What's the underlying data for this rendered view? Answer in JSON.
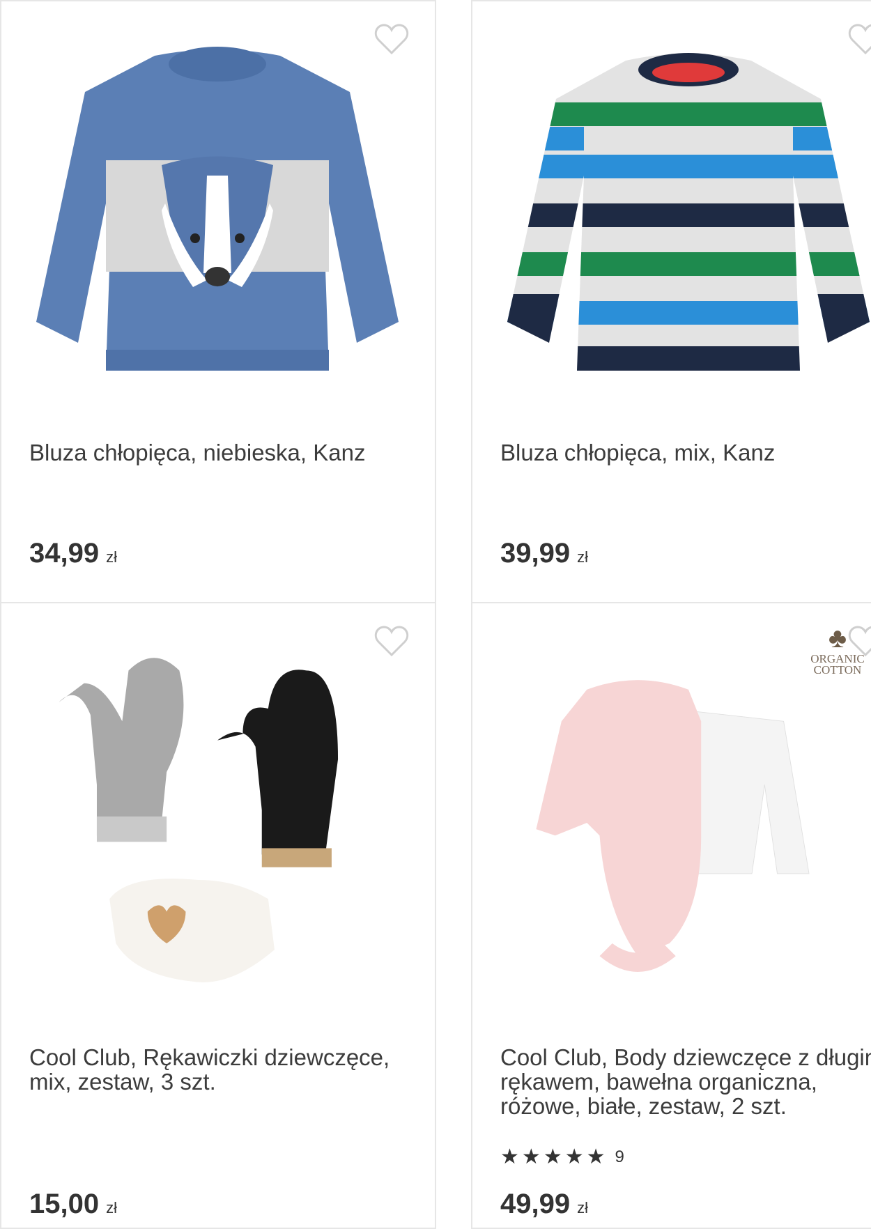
{
  "products": [
    {
      "title": "Bluza chłopięca, niebieska, Kanz",
      "price": "34,99",
      "currency": "zł",
      "favorite_icon": "heart-outline-icon",
      "image": "blue-badger-sweatshirt"
    },
    {
      "title": "Bluza chłopięca, mix, Kanz",
      "price": "39,99",
      "currency": "zł",
      "favorite_icon": "heart-outline-icon",
      "image": "striped-sweatshirt"
    },
    {
      "title": "Cool Club, Rękawiczki dziewczęce, mix, zestaw, 3 szt.",
      "price": "15,00",
      "currency": "zł",
      "favorite_icon": "heart-outline-icon",
      "image": "mittens-set"
    },
    {
      "title": "Cool Club, Body dziewczęce z długim rękawem, bawełna organiczna, różowe, białe, zestaw, 2 szt.",
      "price": "49,99",
      "currency": "zł",
      "favorite_icon": "heart-outline-icon",
      "image": "bodysuit-set",
      "badge": {
        "line1": "ORGANIC",
        "line2": "COTTON"
      },
      "rating": {
        "stars": 4.5,
        "count": "9"
      }
    }
  ]
}
